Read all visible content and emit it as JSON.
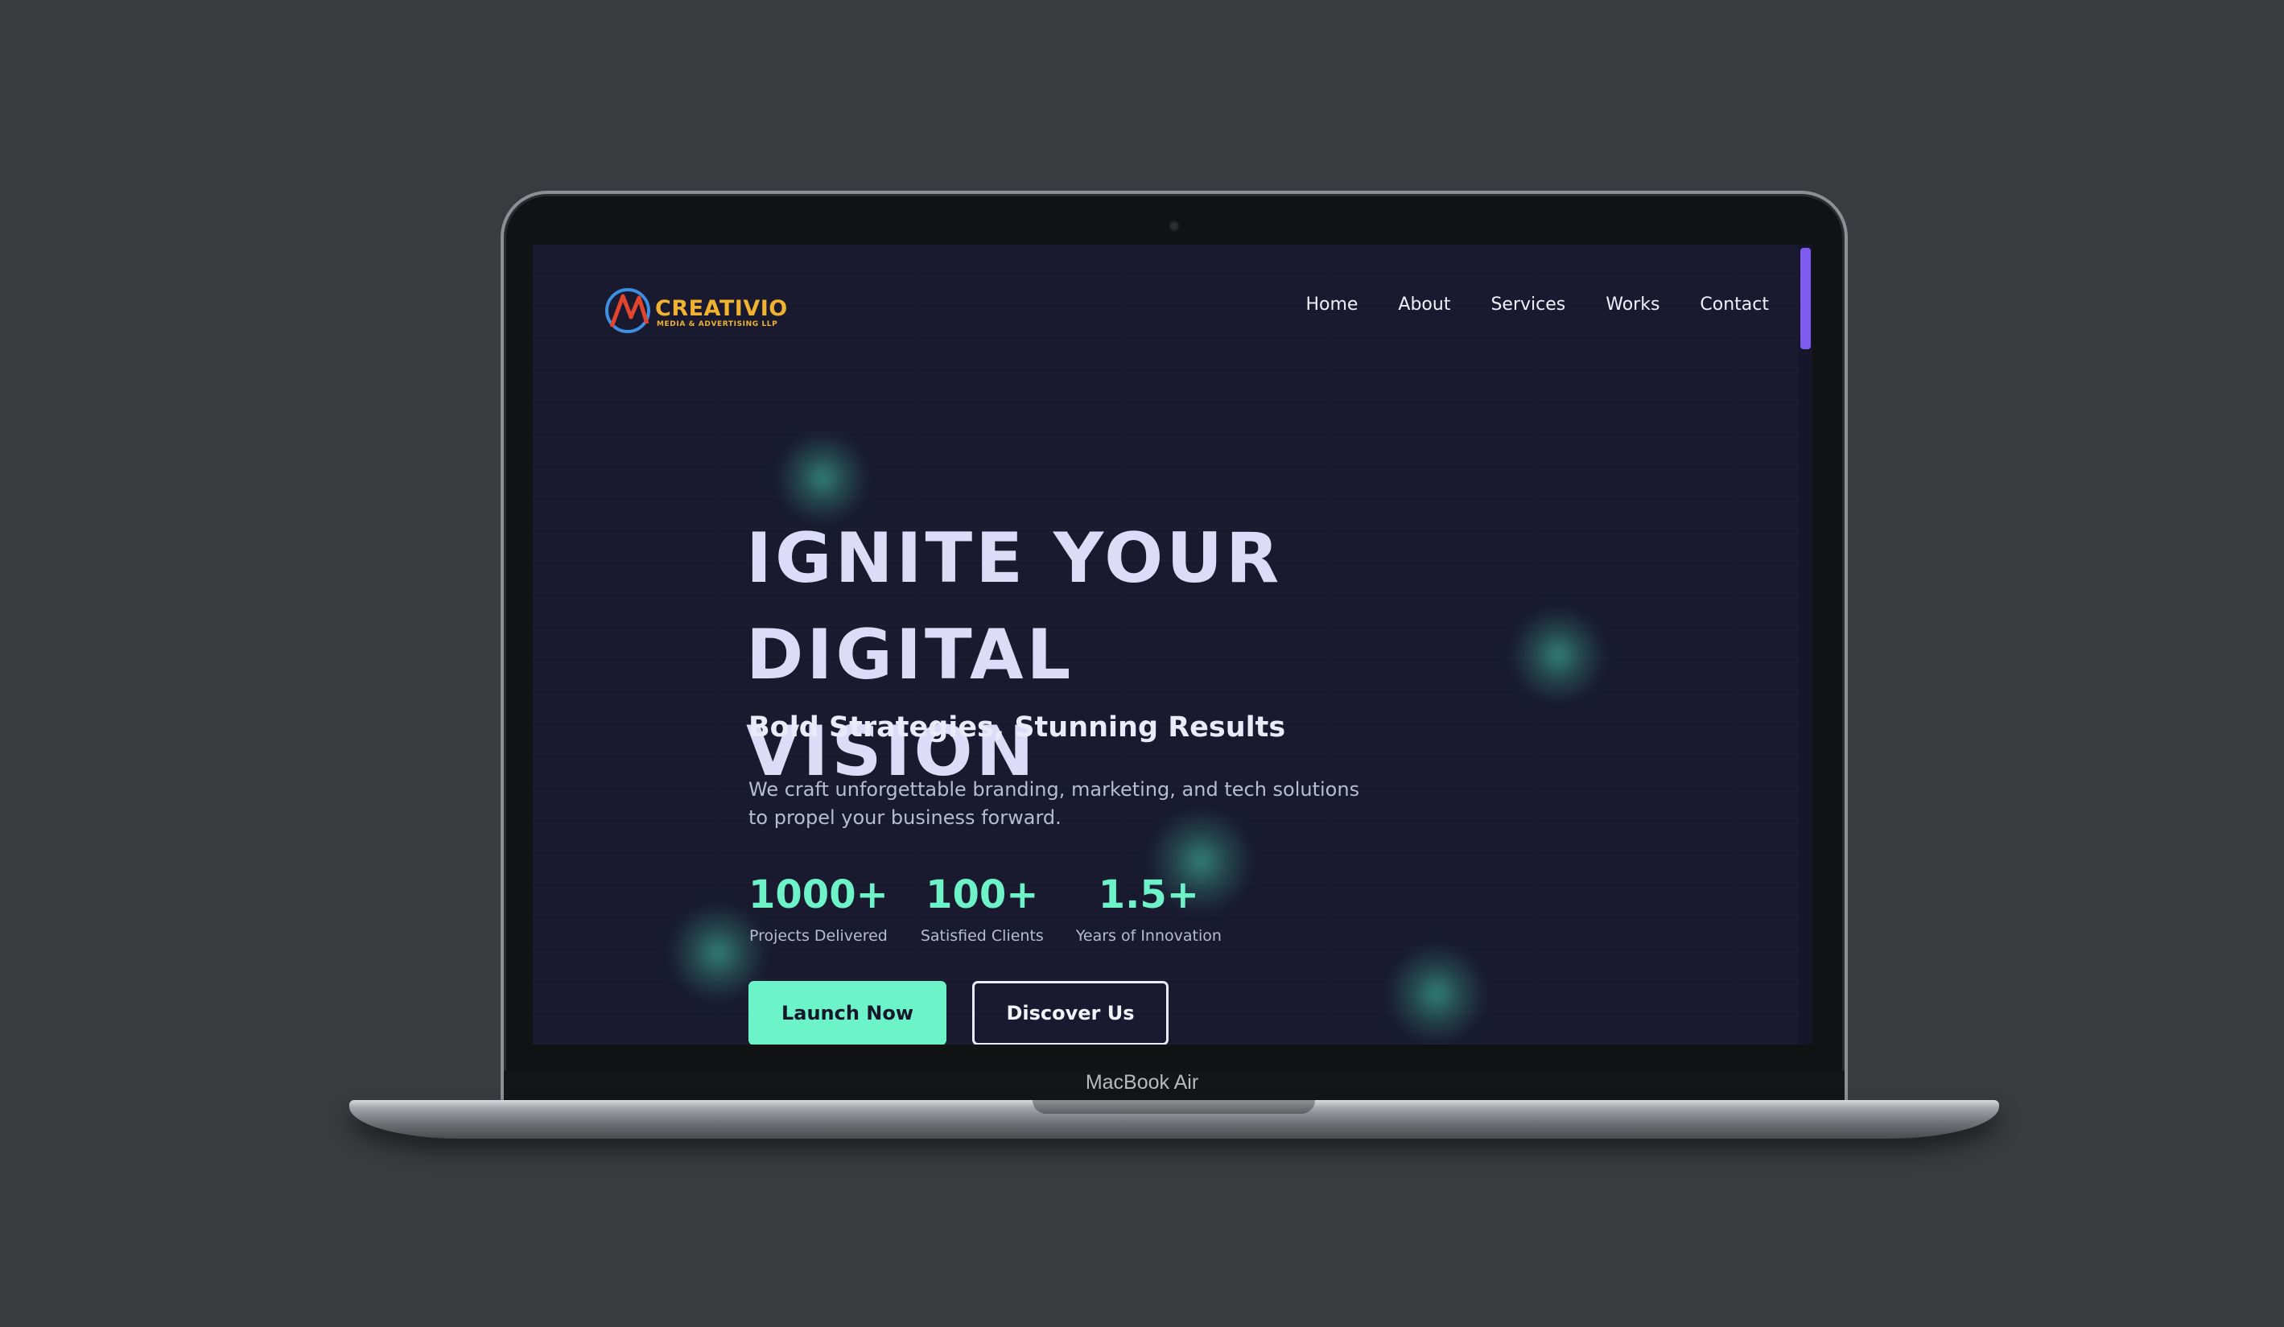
{
  "device": {
    "label": "MacBook Air"
  },
  "site": {
    "logo": {
      "name": "CREATIVIO",
      "tagline": "MEDIA & ADVERTISING LLP"
    },
    "nav": [
      "Home",
      "About",
      "Services",
      "Works",
      "Contact"
    ]
  },
  "hero": {
    "title_line1": "IGNITE YOUR DIGITAL",
    "title_line2": "VISION",
    "subtitle": "Bold Strategies, Stunning Results",
    "description": "We craft unforgettable branding, marketing, and tech solutions to propel your business forward.",
    "stats": [
      {
        "value": "1000+",
        "label": "Projects Delivered"
      },
      {
        "value": "100+",
        "label": "Satisfied Clients"
      },
      {
        "value": "1.5+",
        "label": "Years of Innovation"
      }
    ],
    "buttons": {
      "primary": "Launch Now",
      "secondary": "Discover Us"
    }
  },
  "colors": {
    "background": "#191a2f",
    "accent": "#6df3c7",
    "scrollbar": "#7e5cf0",
    "logo": "#f0b230"
  }
}
